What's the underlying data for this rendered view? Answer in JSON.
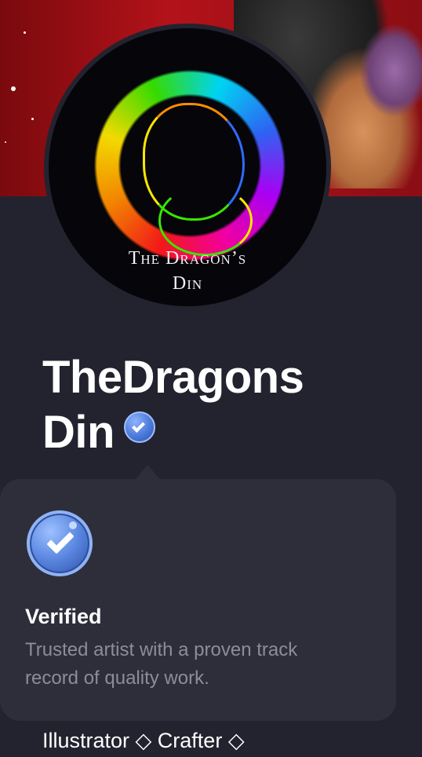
{
  "profile": {
    "avatar_logo": {
      "line1": "The Dragon’s",
      "line2": "Din"
    },
    "name_line1": "TheDragons",
    "name_line2": "Din",
    "tags": "Illustrator ◇ Crafter ◇"
  },
  "tooltip": {
    "title": "Verified",
    "description": "Trusted artist with a proven track record of quality work."
  },
  "colors": {
    "background": "#23232f",
    "card": "#2e2e3b",
    "badge": "#4c7ad8",
    "muted_text": "#8c8c9a"
  },
  "icons": {
    "verified_badge": "verified-check-icon"
  }
}
